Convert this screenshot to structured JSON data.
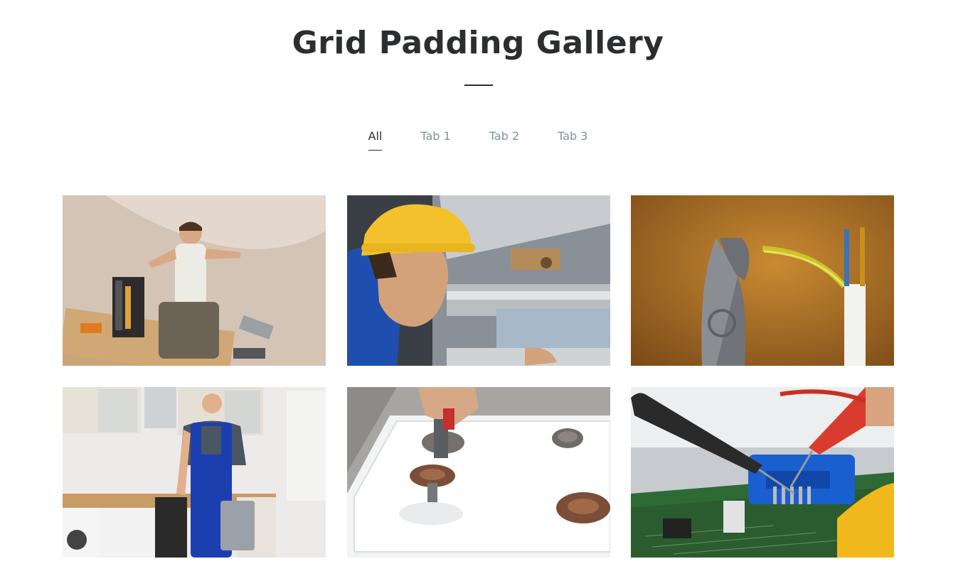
{
  "header": {
    "title": "Grid Padding Gallery"
  },
  "tabs": [
    {
      "label": "All",
      "active": true
    },
    {
      "label": "Tab 1",
      "active": false
    },
    {
      "label": "Tab 2",
      "active": false
    },
    {
      "label": "Tab 3",
      "active": false
    }
  ],
  "gallery": {
    "items": [
      {
        "subject": "handyman-with-toolbox-on-floor"
      },
      {
        "subject": "worker-in-yellow-hard-hat-inspecting-pipes"
      },
      {
        "subject": "pliers-cutting-electrical-wire"
      },
      {
        "subject": "repairman-in-blue-overalls-in-kitchen"
      },
      {
        "subject": "repairing-gas-stove-burner"
      },
      {
        "subject": "multimeter-probes-on-circuit-board"
      }
    ]
  },
  "colors": {
    "title": "#2b2d2f",
    "tab_inactive": "#7d9596",
    "tab_active": "#2b2d2f"
  }
}
